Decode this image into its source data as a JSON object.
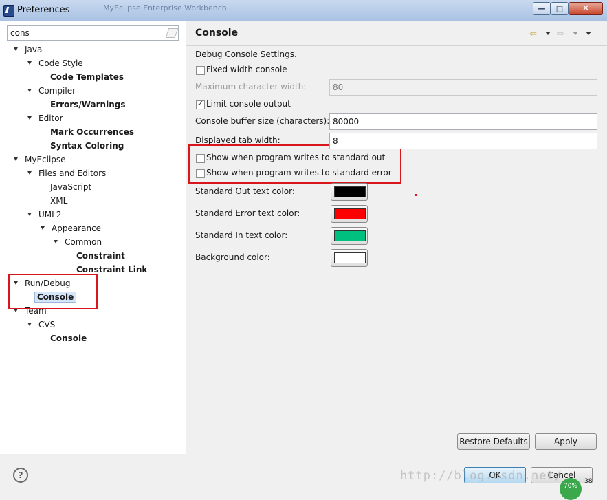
{
  "window": {
    "title": "Preferences",
    "background_title": "MyEclipse Enterprise Workbench"
  },
  "filter": {
    "value": "cons"
  },
  "tree": [
    {
      "label": "Java",
      "bold": false,
      "expandable": true
    },
    {
      "label": "Code Style",
      "bold": false,
      "expandable": true
    },
    {
      "label": "Code Templates",
      "bold": true,
      "expandable": false
    },
    {
      "label": "Compiler",
      "bold": false,
      "expandable": true
    },
    {
      "label": "Errors/Warnings",
      "bold": true,
      "expandable": false
    },
    {
      "label": "Editor",
      "bold": false,
      "expandable": true
    },
    {
      "label": "Mark Occurrences",
      "bold": true,
      "expandable": false
    },
    {
      "label": "Syntax Coloring",
      "bold": true,
      "expandable": false
    },
    {
      "label": "MyEclipse",
      "bold": false,
      "expandable": true
    },
    {
      "label": "Files and Editors",
      "bold": false,
      "expandable": true
    },
    {
      "label": "JavaScript",
      "bold": false,
      "expandable": false
    },
    {
      "label": "XML",
      "bold": false,
      "expandable": false
    },
    {
      "label": "UML2",
      "bold": false,
      "expandable": true
    },
    {
      "label": "Appearance",
      "bold": false,
      "expandable": true
    },
    {
      "label": "Common",
      "bold": false,
      "expandable": true
    },
    {
      "label": "Constraint",
      "bold": true,
      "expandable": false
    },
    {
      "label": "Constraint Link",
      "bold": true,
      "expandable": false
    },
    {
      "label": "Run/Debug",
      "bold": false,
      "expandable": true
    },
    {
      "label": "Console",
      "bold": true,
      "expandable": false,
      "selected": true
    },
    {
      "label": "Team",
      "bold": false,
      "expandable": true
    },
    {
      "label": "CVS",
      "bold": false,
      "expandable": true
    },
    {
      "label": "Console",
      "bold": true,
      "expandable": false
    }
  ],
  "page": {
    "title": "Console",
    "section_label": "Debug Console Settings.",
    "fixed_width_label": "Fixed width console",
    "fixed_width_checked": false,
    "max_char_label": "Maximum character width:",
    "max_char_value": "80",
    "limit_output_label": "Limit console output",
    "limit_output_checked": true,
    "buffer_size_label": "Console buffer size (characters):",
    "buffer_size_value": "80000",
    "tab_width_label": "Displayed tab width:",
    "tab_width_value": "8",
    "show_stdout_label": "Show when program writes to standard out",
    "show_stdout_checked": false,
    "show_stderr_label": "Show when program writes to standard error",
    "show_stderr_checked": false,
    "colors": [
      {
        "label": "Standard Out text color:",
        "color": "#000000"
      },
      {
        "label": "Standard Error text color:",
        "color": "#ff0000"
      },
      {
        "label": "Standard In text color:",
        "color": "#00c080"
      },
      {
        "label": "Background color:",
        "color": "#ffffff"
      }
    ]
  },
  "buttons": {
    "restore_defaults": "Restore Defaults",
    "apply": "Apply",
    "ok": "OK",
    "cancel": "Cancel"
  },
  "watermark": "http://blog.csdn.net/",
  "tray": {
    "badge": "70%",
    "number": "38"
  },
  "accent_colors": {
    "highlight_box": "#d8161b",
    "selection": "#d6e6fa"
  }
}
